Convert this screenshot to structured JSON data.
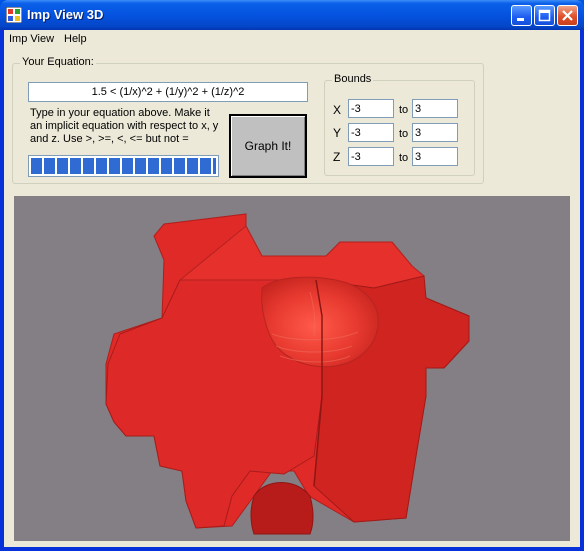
{
  "window": {
    "title": "Imp View 3D",
    "controls": [
      "minimize",
      "maximize",
      "close"
    ]
  },
  "menu": {
    "items": [
      "Imp View",
      "Help"
    ]
  },
  "equation_group": {
    "label": "Your Equation:",
    "equation_value": "1.5 < (1/x)^2 + (1/y)^2 + (1/z)^2",
    "help_text": "Type in your equation above. Make it an implicit equation with respect to x, y and z. Use >, >=, <, <= but not =",
    "progress_fraction": 1.0,
    "graph_button_label": "Graph It!"
  },
  "bounds": {
    "label": "Bounds",
    "rows": [
      {
        "axis": "X",
        "from": "-3",
        "to_label": "to",
        "to": "3"
      },
      {
        "axis": "Y",
        "from": "-3",
        "to_label": "to",
        "to": "3"
      },
      {
        "axis": "Z",
        "from": "-3",
        "to_label": "to",
        "to": "3"
      }
    ]
  },
  "viewport": {
    "background_color": "#847f84",
    "surface_color": "#e02828"
  },
  "colors": {
    "titlebar": "#0553e0",
    "window_face": "#ece9d8",
    "progress": "#2f6bd3"
  }
}
